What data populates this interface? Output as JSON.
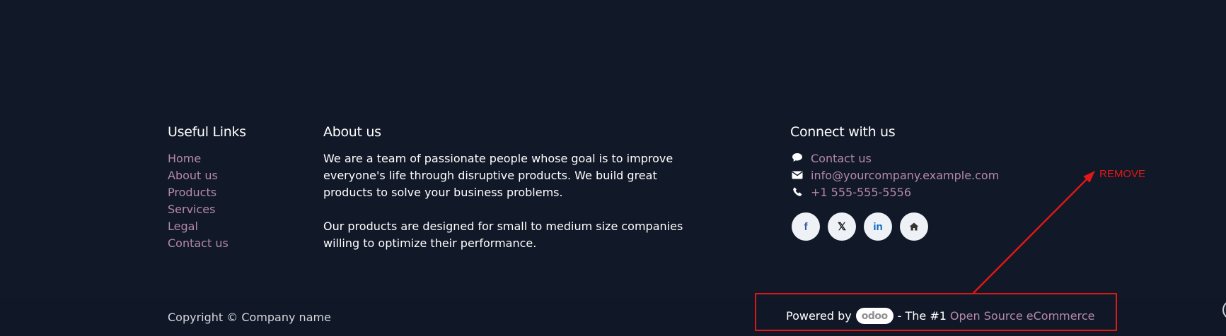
{
  "useful_links": {
    "title": "Useful Links",
    "items": [
      "Home",
      "About us",
      "Products",
      "Services",
      "Legal",
      "Contact us"
    ]
  },
  "about": {
    "title": "About us",
    "paragraph1": "We are a team of passionate people whose goal is to improve everyone's life through disruptive products. We build great products to solve your business problems.",
    "paragraph2": "Our products are designed for small to medium size companies willing to optimize their performance."
  },
  "connect": {
    "title": "Connect with us",
    "contact_label": "Contact us",
    "email": "info@yourcompany.example.com",
    "phone": "+1 555-555-5556",
    "social": [
      {
        "icon": "facebook-icon",
        "glyph": "f",
        "color": "#3b5998"
      },
      {
        "icon": "x-twitter-icon",
        "glyph": "𝕏",
        "color": "#111111"
      },
      {
        "icon": "linkedin-icon",
        "glyph": "in",
        "color": "#0a66c2"
      },
      {
        "icon": "home-icon",
        "glyph": "⌂",
        "color": "#333333"
      }
    ]
  },
  "bottom": {
    "copyright": "Copyright © Company name",
    "powered_by": "Powered by",
    "badge": "odoo",
    "the_one": "- The #1",
    "open_source": "Open Source eCommerce"
  },
  "annotation": {
    "label": "REMOVE",
    "color": "#e01717"
  }
}
